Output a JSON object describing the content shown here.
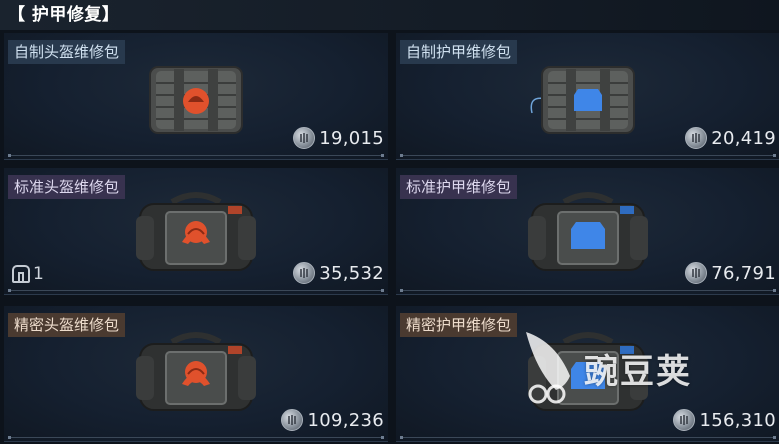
{
  "header": {
    "title": "【 护甲修复】"
  },
  "items": [
    {
      "label": "自制头盔维修包",
      "price": "19,015",
      "kind": "helmet",
      "tier": "homemade",
      "emblem_color": "#e0512c",
      "stock": null
    },
    {
      "label": "自制护甲维修包",
      "price": "20,419",
      "kind": "armor",
      "tier": "homemade",
      "emblem_color": "#3f86e8",
      "stock": null
    },
    {
      "label": "标准头盔维修包",
      "price": "35,532",
      "kind": "helmet",
      "tier": "standard",
      "emblem_color": "#e0512c",
      "stock": "1"
    },
    {
      "label": "标准护甲维修包",
      "price": "76,791",
      "kind": "armor",
      "tier": "standard",
      "emblem_color": "#3f86e8",
      "stock": null
    },
    {
      "label": "精密头盔维修包",
      "price": "109,236",
      "kind": "helmet",
      "tier": "precise",
      "emblem_color": "#e0512c",
      "stock": null
    },
    {
      "label": "精密护甲维修包",
      "price": "156,310",
      "kind": "armor",
      "tier": "precise",
      "emblem_color": "#3f86e8",
      "stock": null
    }
  ],
  "watermark": {
    "text": "豌豆荚"
  },
  "icons": {
    "currency": "coin-icon",
    "stock": "backpack-icon"
  }
}
